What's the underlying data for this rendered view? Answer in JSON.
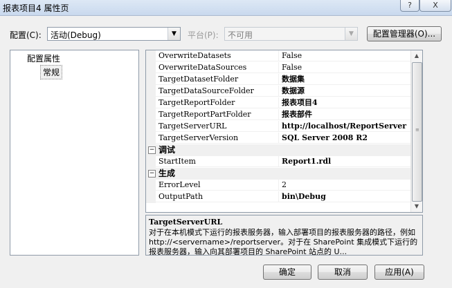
{
  "window": {
    "title": "报表项目4 属性页",
    "help_glyph": "?",
    "close_glyph": "X"
  },
  "toolbar": {
    "config_label": "配置(C):",
    "config_value": "活动(Debug)",
    "platform_label": "平台(P):",
    "platform_value": "不可用",
    "config_manager_label": "配置管理器(O)..."
  },
  "tree": {
    "root": "配置属性",
    "child": "常规"
  },
  "properties": {
    "rows": [
      {
        "name": "OverwriteDatasets",
        "value": "False"
      },
      {
        "name": "OverwriteDataSources",
        "value": "False"
      },
      {
        "name": "TargetDatasetFolder",
        "value": "数据集"
      },
      {
        "name": "TargetDataSourceFolder",
        "value": "数据源"
      },
      {
        "name": "TargetReportFolder",
        "value": "报表项目4"
      },
      {
        "name": "TargetReportPartFolder",
        "value": "报表部件"
      },
      {
        "name": "TargetServerURL",
        "value": "http://localhost/ReportServer"
      },
      {
        "name": "TargetServerVersion",
        "value": "SQL Server 2008 R2"
      }
    ],
    "debug_category": "调试",
    "debug_rows": [
      {
        "name": "StartItem",
        "value": "Report1.rdl"
      }
    ],
    "build_category": "生成",
    "build_rows": [
      {
        "name": "ErrorLevel",
        "value": "2"
      },
      {
        "name": "OutputPath",
        "value": "bin\\Debug"
      }
    ],
    "collapse_glyph": "⊟"
  },
  "description": {
    "title": "TargetServerURL",
    "text": "对于在本机模式下运行的报表服务器，输入部署项目的报表服务器的路径，例如 http://<servername>/reportserver。对于在 SharePoint 集成模式下运行的报表服务器，输入向其部署项目的 SharePoint 站点的 U..."
  },
  "buttons": {
    "ok": "确定",
    "cancel": "取消",
    "apply": "应用(A)"
  }
}
